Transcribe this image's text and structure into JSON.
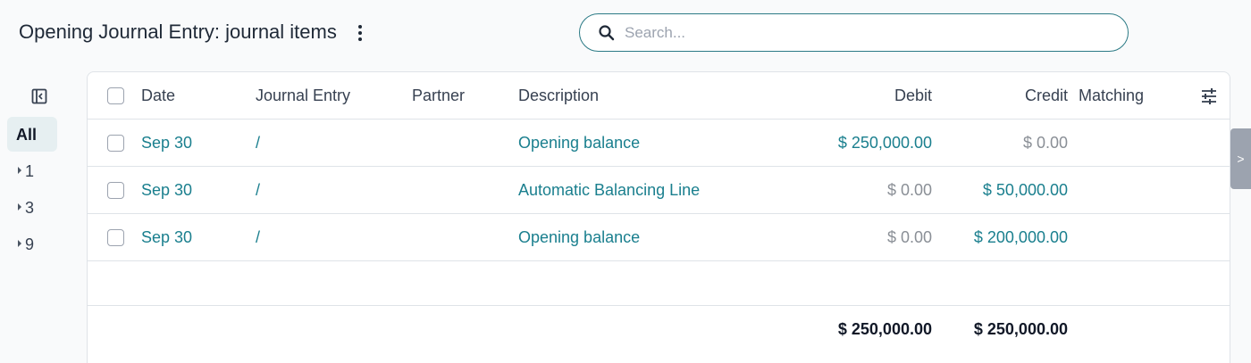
{
  "header": {
    "title": "Opening Journal Entry: journal items",
    "menu_icon": "kebab-menu-icon"
  },
  "search": {
    "placeholder": "Search...",
    "value": "",
    "icon": "search-icon"
  },
  "sidebar": {
    "toggle_icon": "sidebar-collapse-icon",
    "all_label": "All",
    "groups": [
      {
        "label": "1"
      },
      {
        "label": "3"
      },
      {
        "label": "9"
      }
    ]
  },
  "table": {
    "columns": {
      "date": "Date",
      "journal_entry": "Journal Entry",
      "partner": "Partner",
      "description": "Description",
      "debit": "Debit",
      "credit": "Credit",
      "matching": "Matching"
    },
    "settings_icon": "column-settings-icon",
    "rows": [
      {
        "date": "Sep 30",
        "journal_entry": "/",
        "partner": "",
        "description": "Opening balance",
        "debit": "$ 250,000.00",
        "credit": "$ 0.00",
        "matching": ""
      },
      {
        "date": "Sep 30",
        "journal_entry": "/",
        "partner": "",
        "description": "Automatic Balancing Line",
        "debit": "$ 0.00",
        "credit": "$ 50,000.00",
        "matching": ""
      },
      {
        "date": "Sep 30",
        "journal_entry": "/",
        "partner": "",
        "description": "Opening balance",
        "debit": "$ 0.00",
        "credit": "$ 200,000.00",
        "matching": ""
      }
    ],
    "totals": {
      "debit": "$ 250,000.00",
      "credit": "$ 250,000.00"
    }
  },
  "edge_tab": {
    "label": ">"
  },
  "colors": {
    "accent": "#1a7f8e",
    "search_border": "#2b7a85",
    "muted_value": "#8a8f96",
    "active_group_bg": "#e6eff1"
  }
}
